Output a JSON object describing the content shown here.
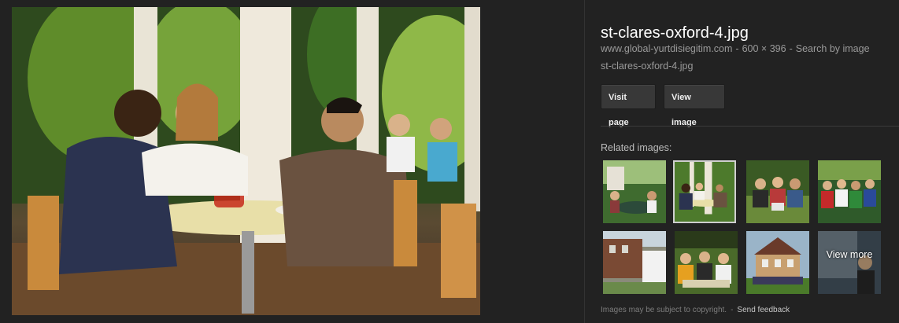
{
  "image": {
    "title": "st-clares-oxford-4.jpg",
    "source_domain": "www.global-yurtdisiegitim.com",
    "dimensions": "600 × 396",
    "search_by_image_label": "Search by image",
    "filename": "st-clares-oxford-4.jpg",
    "separator": "-"
  },
  "buttons": {
    "visit_page": "Visit page",
    "view_image": "View image"
  },
  "related": {
    "label": "Related images:",
    "view_more": "View more"
  },
  "footer": {
    "copyright_notice": "Images may be subject to copyright.",
    "separator": "-",
    "send_feedback": "Send feedback"
  },
  "colors": {
    "background": "#222222",
    "title": "#ffffff",
    "meta_text": "#9a9a9a",
    "button_bg": "#383838"
  }
}
